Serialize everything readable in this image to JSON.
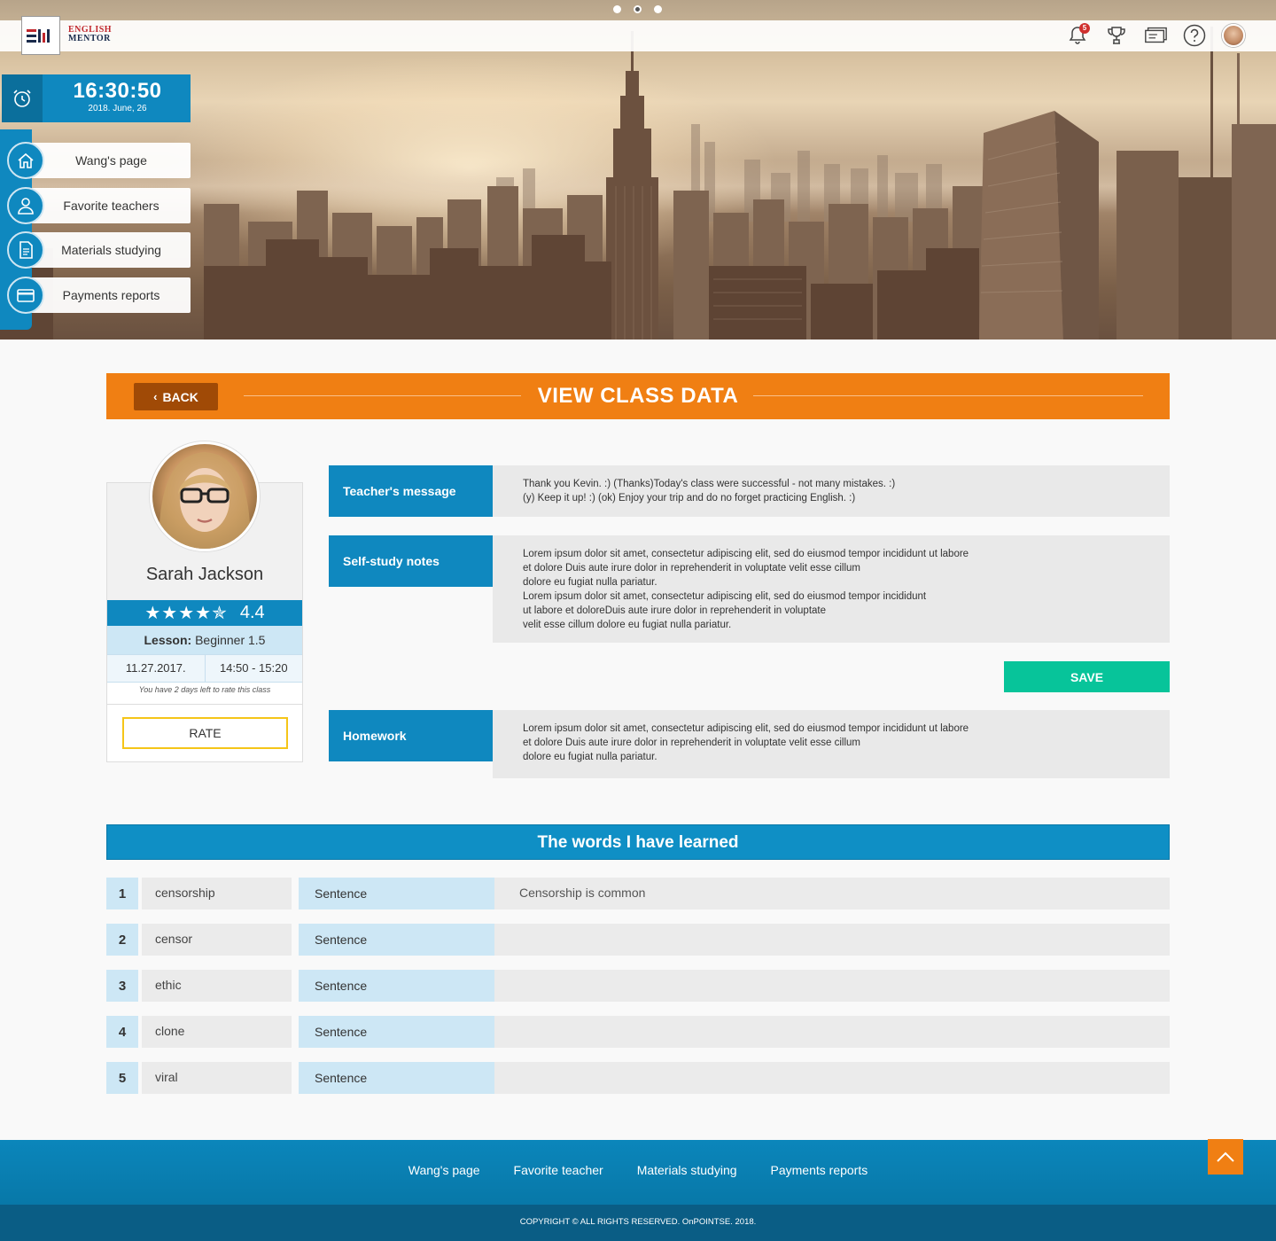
{
  "header": {
    "logo_line1": "ENGLISH",
    "logo_line2": "MENTOR",
    "notification_count": "5"
  },
  "clock": {
    "time": "16:30:50",
    "date": "2018. June, 26"
  },
  "sidebar": {
    "items": [
      {
        "label": "Wang's page",
        "icon": "home-icon"
      },
      {
        "label": "Favorite teachers",
        "icon": "user-icon"
      },
      {
        "label": "Materials studying",
        "icon": "document-icon"
      },
      {
        "label": "Payments reports",
        "icon": "credit-card-icon"
      }
    ]
  },
  "class_bar": {
    "back_label": "BACK",
    "title": "VIEW CLASS DATA"
  },
  "teacher": {
    "name": "Sarah Jackson",
    "stars": "★★★★✯",
    "rating_value": 4.4,
    "rating": "4.4",
    "lesson_label": "Lesson:",
    "lesson_value": " Beginner 1.5",
    "date": "11.27.2017.",
    "time_range": "14:50 - 15:20",
    "rate_note": "You have 2 days left to rate this class",
    "rate_label": "RATE"
  },
  "sections": {
    "teacher_message": {
      "label": "Teacher's message",
      "text": "Thank you Kevin. :) (Thanks)Today's class were successful - not many mistakes. :)\n(y) Keep it up! :) (ok) Enjoy your trip and do no forget practicing English. :)"
    },
    "self_study": {
      "label": "Self-study notes",
      "text": "Lorem ipsum dolor sit amet, consectetur adipiscing elit, sed do eiusmod tempor incididunt ut labore\net dolore Duis aute irure dolor in reprehenderit in voluptate velit esse cillum\ndolore eu fugiat nulla pariatur.\nLorem ipsum dolor sit amet, consectetur adipiscing elit, sed do eiusmod tempor incididunt\nut labore et doloreDuis aute irure dolor in reprehenderit in voluptate\nvelit esse cillum dolore eu fugiat nulla pariatur."
    },
    "save_label": "SAVE",
    "homework": {
      "label": "Homework",
      "text": "Lorem ipsum dolor sit amet, consectetur adipiscing elit, sed do eiusmod tempor incididunt ut labore\net dolore Duis aute irure dolor in reprehenderit in voluptate velit esse cillum\ndolore eu fugiat nulla pariatur."
    }
  },
  "words": {
    "title": "The words I have learned",
    "rows": [
      {
        "num": "1",
        "word": "censorship",
        "label": "Sentence",
        "sentence": "Censorship is common"
      },
      {
        "num": "2",
        "word": "censor",
        "label": "Sentence",
        "sentence": ""
      },
      {
        "num": "3",
        "word": "ethic",
        "label": "Sentence",
        "sentence": ""
      },
      {
        "num": "4",
        "word": "clone",
        "label": "Sentence",
        "sentence": ""
      },
      {
        "num": "5",
        "word": "viral",
        "label": "Sentence",
        "sentence": ""
      }
    ]
  },
  "footer": {
    "links": [
      "Wang's page",
      "Favorite teacher",
      "Materials studying",
      "Payments reports"
    ],
    "copyright": "COPYRIGHT © ALL RIGHTS RESERVED. OnPOINTSE. 2018."
  },
  "colors": {
    "primary_blue": "#0f88bf",
    "orange": "#f07f13",
    "save_green": "#07c49a",
    "light_blue": "#cde7f5"
  }
}
